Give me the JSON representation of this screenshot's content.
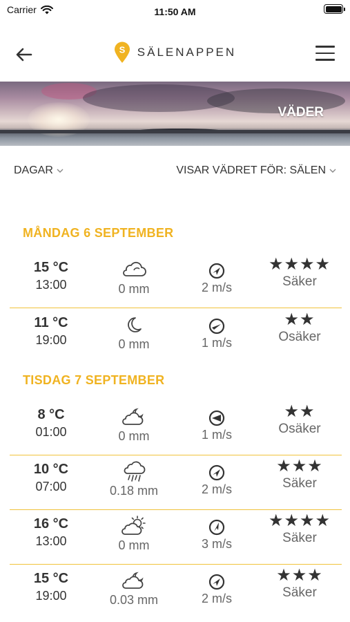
{
  "status": {
    "carrier": "Carrier",
    "time": "11:50 AM"
  },
  "header": {
    "app_name": "SÄLENAPPEN",
    "pin_letter": "S"
  },
  "hero": {
    "label": "VÄDER"
  },
  "filters": {
    "days": "DAGAR",
    "place": "VISAR VÄDRET FÖR: SÄLEN"
  },
  "days": [
    {
      "title": "MÅNDAG 6 SEPTEMBER",
      "rows": [
        {
          "temp": "15 °C",
          "time": "13:00",
          "weather_icon": "cloudy-icon",
          "precip": "0 mm",
          "wind": "2 m/s",
          "stars": "★★★★",
          "rating": "Säker"
        },
        {
          "temp": "11 °C",
          "time": "19:00",
          "weather_icon": "moon-icon",
          "precip": "0 mm",
          "wind": "1 m/s",
          "stars": "★★",
          "rating": "Osäker"
        }
      ]
    },
    {
      "title": "TISDAG 7 SEPTEMBER",
      "rows": [
        {
          "temp": "8 °C",
          "time": "01:00",
          "weather_icon": "cloudy-moon-icon",
          "precip": "0 mm",
          "wind": "1 m/s",
          "stars": "★★",
          "rating": "Osäker"
        },
        {
          "temp": "10 °C",
          "time": "07:00",
          "weather_icon": "rain-icon",
          "precip": "0.18 mm",
          "wind": "2 m/s",
          "stars": "★★★",
          "rating": "Säker"
        },
        {
          "temp": "16 °C",
          "time": "13:00",
          "weather_icon": "partly-sunny-icon",
          "precip": "0 mm",
          "wind": "3 m/s",
          "stars": "★★★★",
          "rating": "Säker"
        },
        {
          "temp": "15 °C",
          "time": "19:00",
          "weather_icon": "cloudy-moon-icon",
          "precip": "0.03 mm",
          "wind": "2 m/s",
          "stars": "★★★",
          "rating": "Säker"
        }
      ]
    }
  ],
  "colors": {
    "accent": "#f0b321",
    "divider": "#f0c23a",
    "text": "#333333",
    "muted": "#666666"
  }
}
